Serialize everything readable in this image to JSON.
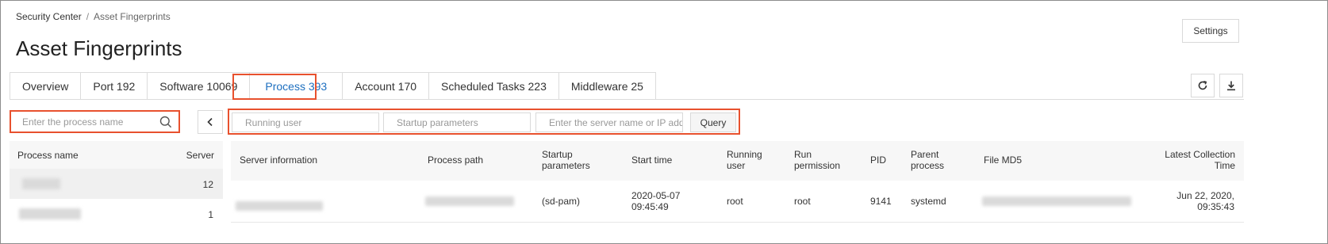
{
  "breadcrumb": {
    "root": "Security Center",
    "separator": "/",
    "current": "Asset Fingerprints"
  },
  "page_title": "Asset Fingerprints",
  "settings_label": "Settings",
  "tabs": [
    {
      "label": "Overview"
    },
    {
      "label": "Port 192"
    },
    {
      "label": "Software 10069"
    },
    {
      "label": "Process 393"
    },
    {
      "label": "Account 170"
    },
    {
      "label": "Scheduled Tasks 223"
    },
    {
      "label": "Middleware 25"
    }
  ],
  "active_tab": "Process 393",
  "toolbar_icons": [
    "refresh-icon",
    "download-icon"
  ],
  "left_panel": {
    "search_placeholder": "Enter the process name",
    "columns": {
      "name": "Process name",
      "server": "Server"
    },
    "rows": [
      {
        "server": "12"
      },
      {
        "server": "1"
      }
    ]
  },
  "filters": {
    "running_user_placeholder": "Running user",
    "startup_params_placeholder": "Startup parameters",
    "server_placeholder": "Enter the server name or IP add",
    "query_label": "Query"
  },
  "table": {
    "headers": {
      "server_info": "Server information",
      "process_path": "Process path",
      "startup_params_1": "Startup",
      "startup_params_2": "parameters",
      "start_time": "Start time",
      "running_user_1": "Running",
      "running_user_2": "user",
      "run_permission_1": "Run",
      "run_permission_2": "permission",
      "pid": "PID",
      "parent_process_1": "Parent",
      "parent_process_2": "process",
      "file_md5": "File MD5",
      "latest_collection_1": "Latest Collection",
      "latest_collection_2": "Time"
    },
    "rows": [
      {
        "startup_params": "(sd-pam)",
        "start_time_1": "2020-05-07",
        "start_time_2": "09:45:49",
        "running_user": "root",
        "run_permission": "root",
        "pid": "9141",
        "parent_process": "systemd",
        "latest_1": "Jun 22, 2020,",
        "latest_2": "09:35:43"
      }
    ]
  },
  "colors": {
    "highlight": "#e8512e",
    "active_tab": "#1d6fbf"
  }
}
